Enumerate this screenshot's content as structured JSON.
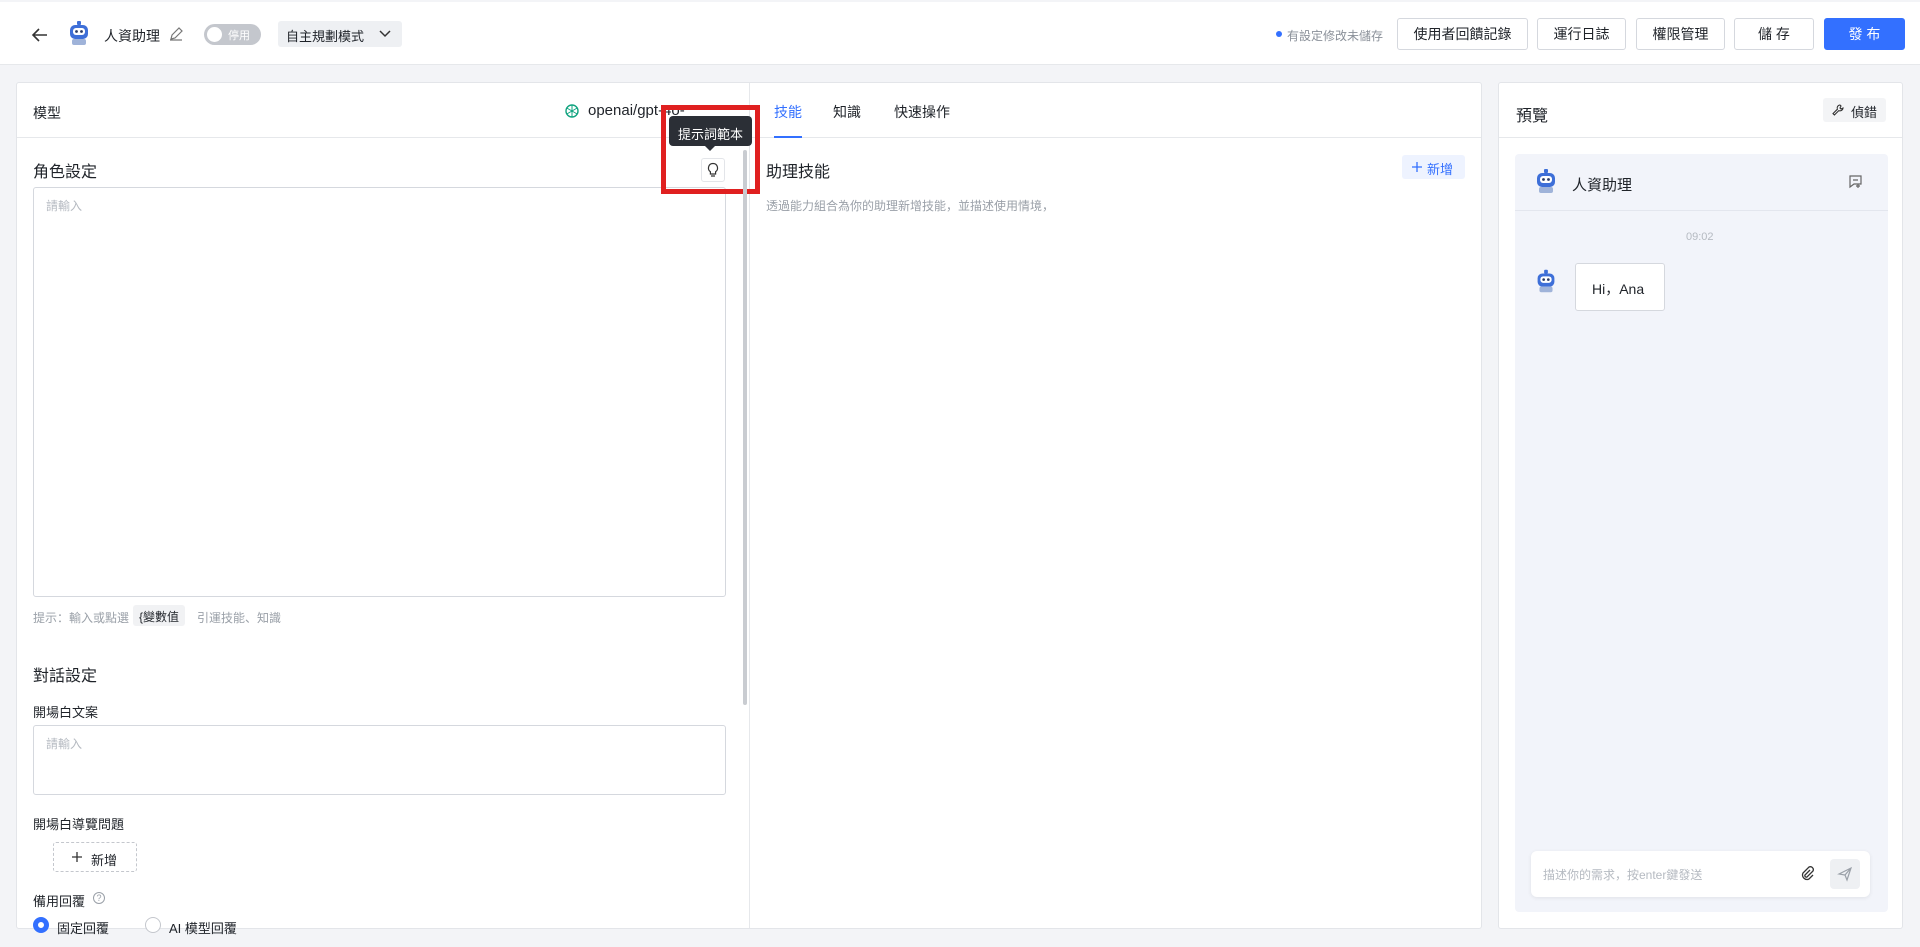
{
  "header": {
    "assistant_name": "人資助理",
    "toggle_label": "停用",
    "mode_label": "自主規劃模式",
    "unsaved_notice": "有設定修改未儲存",
    "feedback_button": "使用者回饋記錄",
    "log_button": "運行日誌",
    "permission_button": "權限管理",
    "save_button": "儲 存",
    "publish_button": "發 布"
  },
  "left": {
    "model_label": "模型",
    "model_value": "openai/gpt-4o-",
    "tooltip": "提示詞範本",
    "role_title": "角色設定",
    "role_placeholder": "請輸入",
    "role_hint_prefix": "提示：輸入或點選",
    "variable_chip": "{變數值",
    "role_hint_suffix": "引運技能、知識",
    "dialog_title": "對話設定",
    "opening_label": "開場白文案",
    "opening_placeholder": "請輸入",
    "guide_label": "開場白導覽問題",
    "add_label": "新增",
    "fallback_label": "備用回覆",
    "radio_fixed": "固定回覆",
    "radio_ai": "AI 模型回覆"
  },
  "middle": {
    "tabs": [
      "技能",
      "知識",
      "快速操作"
    ],
    "skills_title": "助理技能",
    "add_label": "新增",
    "skills_desc": "透過能力組合為你的助理新增技能，並描述使用情境，"
  },
  "preview": {
    "title": "預覽",
    "debug_label": "偵錯",
    "chat_name": "人資助理",
    "time": "09:02",
    "message": "Hi，Ana",
    "input_placeholder": "描述你的需求，按enter鍵發送"
  },
  "colors": {
    "primary": "#3370ff",
    "highlight": "#e02020",
    "tooltip_bg": "#2b2f36"
  }
}
